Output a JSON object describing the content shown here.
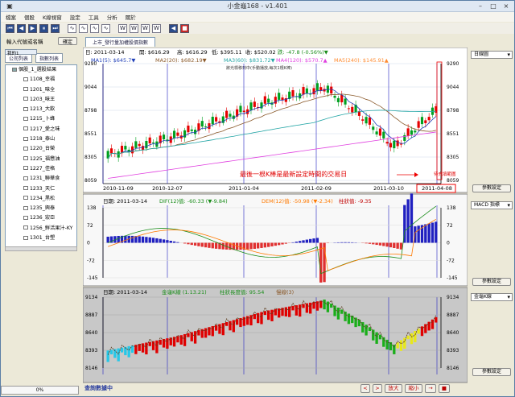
{
  "app": {
    "title": "小金龜168 - v1.401"
  },
  "menu": [
    "檔案",
    "個股",
    "K線視窗",
    "設定",
    "工具",
    "分析",
    "關於"
  ],
  "toolbar_icons": [
    "play-first-icon",
    "play-prev-icon",
    "play-icon",
    "pause-icon",
    "play-next-icon",
    "wave1-icon",
    "wave2-icon",
    "wave3-icon",
    "wave4-icon",
    "wave5-icon",
    "wave6-icon",
    "wave7-icon",
    "back-icon",
    "stop-icon"
  ],
  "left_panel": {
    "input_label": "輸入代號或名稱",
    "confirm_btn": "確定",
    "tabs": [
      "公司列表",
      "指數列表"
    ],
    "subtab": "我的1_",
    "tree": [
      {
        "label": "個股_1_選股結果",
        "root": true
      },
      {
        "label": "1108_幸福"
      },
      {
        "label": "1201_味全"
      },
      {
        "label": "1203_味王"
      },
      {
        "label": "1213_大飲"
      },
      {
        "label": "1215_卜蜂"
      },
      {
        "label": "1217_愛之味"
      },
      {
        "label": "1218_泰山"
      },
      {
        "label": "1220_台榮"
      },
      {
        "label": "1225_福懋油"
      },
      {
        "label": "1227_佳格"
      },
      {
        "label": "1231_聯華食"
      },
      {
        "label": "1233_天仁"
      },
      {
        "label": "1234_黑松"
      },
      {
        "label": "1235_興泰"
      },
      {
        "label": "1236_宏亞"
      },
      {
        "label": "1256_鮮活果汁-KY"
      },
      {
        "label": "1301_台塑"
      }
    ],
    "progress": "0%"
  },
  "doc_tab": "上市_發行量加權股價指數",
  "price_panel": {
    "header1_date": "日: 2011-03-14",
    "header1_open": "開: $616.29",
    "header1_high": "高: $616.29",
    "header1_low": "低: $395.11",
    "header1_close": "收: $520.02",
    "header1_change": "跌: -47.8 (-0.56%)▼",
    "ma5": "MA1(5): $645.7▼",
    "ma20": "MA2(20): $682.19▼",
    "ma60": "MA3(60): $831.72▼",
    "ma120": "MA4(120): $570.7▲",
    "ma240": "MA5(240): $145.91▲",
    "note_small": "將光標移到中(手動播放,每次1根K棒)",
    "annotation": "最後一根K棒是最新設定時間的交易日",
    "annotation_small": "待充填範圍",
    "yticks": [
      "9290",
      "9044",
      "8798",
      "8551",
      "8305",
      "8059"
    ],
    "xticks": [
      "2010-11-09",
      "2010-12-07",
      "2011-01-04",
      "2011-02-09",
      "2011-03-10",
      "2011-04-08"
    ],
    "right_dropdown": "日線圖",
    "right_btn": "參數設定"
  },
  "macd_panel": {
    "date": "日期: 2011-03-14",
    "dif": "DIF(12)值: -60.33 (▼-9.84)",
    "dem": "DEM(12)值: -50.98 (▼-2.34)",
    "osc": "柱狀值: -9.35",
    "yticks": [
      "138",
      "72",
      "0",
      "-72",
      "-145"
    ],
    "right_dropdown": "MACD 指標",
    "right_btn": "參數設定"
  },
  "kd_panel": {
    "date": "日期: 2011-03-14",
    "k": "金龜K線 (1.13.21)",
    "v": "柱狀長度值: 95.54",
    "d": "慢線(3)",
    "yticks": [
      "9134",
      "8887",
      "8640",
      "8393",
      "8146"
    ],
    "right_dropdown": "金龜K線",
    "right_btn": "參數設定"
  },
  "status": {
    "text": "查詢數據中",
    "buttons": [
      "<",
      ">",
      "放大",
      "縮小",
      "→",
      "■"
    ]
  },
  "colors": {
    "up": "#e60000",
    "down": "#00a020",
    "bg": "#ffffff",
    "ma1": "#1f3fb8",
    "ma2": "#8b5a2b",
    "ma3": "#25a6a6",
    "ma4": "#e040e0",
    "ma5": "#ff8c32"
  }
}
